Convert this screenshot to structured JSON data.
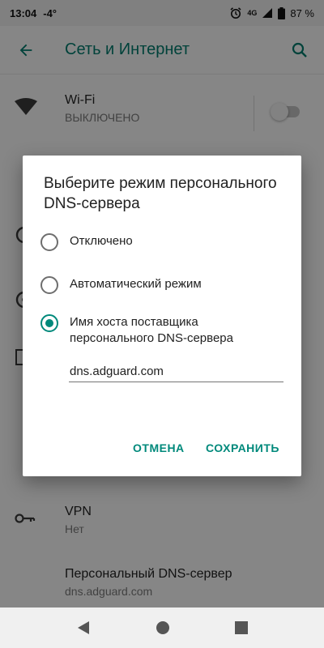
{
  "status_bar": {
    "time": "13:04",
    "temperature": "-4°",
    "network_label": "4G",
    "battery_percent": "87 %",
    "icons": [
      "alarm-icon",
      "signal-icon",
      "battery-icon"
    ]
  },
  "app_bar": {
    "title": "Сеть и Интернет",
    "accent_color": "#00796b"
  },
  "list": {
    "wifi": {
      "title": "Wi-Fi",
      "subtitle": "ВЫКЛЮЧЕНО",
      "toggle_on": false
    },
    "vpn": {
      "title": "VPN",
      "subtitle": "Нет"
    },
    "private_dns": {
      "title": "Персональный DNS-сервер",
      "subtitle": "dns.adguard.com"
    }
  },
  "dialog": {
    "title": "Выберите режим персонального DNS-сервера",
    "options": [
      {
        "label": "Отключено",
        "selected": false
      },
      {
        "label": "Автоматический режим",
        "selected": false
      },
      {
        "label": "Имя хоста поставщика персонального DNS-сервера",
        "selected": true
      }
    ],
    "hostname_value": "dns.adguard.com",
    "cancel_label": "ОТМЕНА",
    "save_label": "СОХРАНИТЬ",
    "accent_color": "#00897b"
  },
  "nav_bar": {
    "icons": [
      "back-icon",
      "home-icon",
      "recents-icon"
    ]
  }
}
